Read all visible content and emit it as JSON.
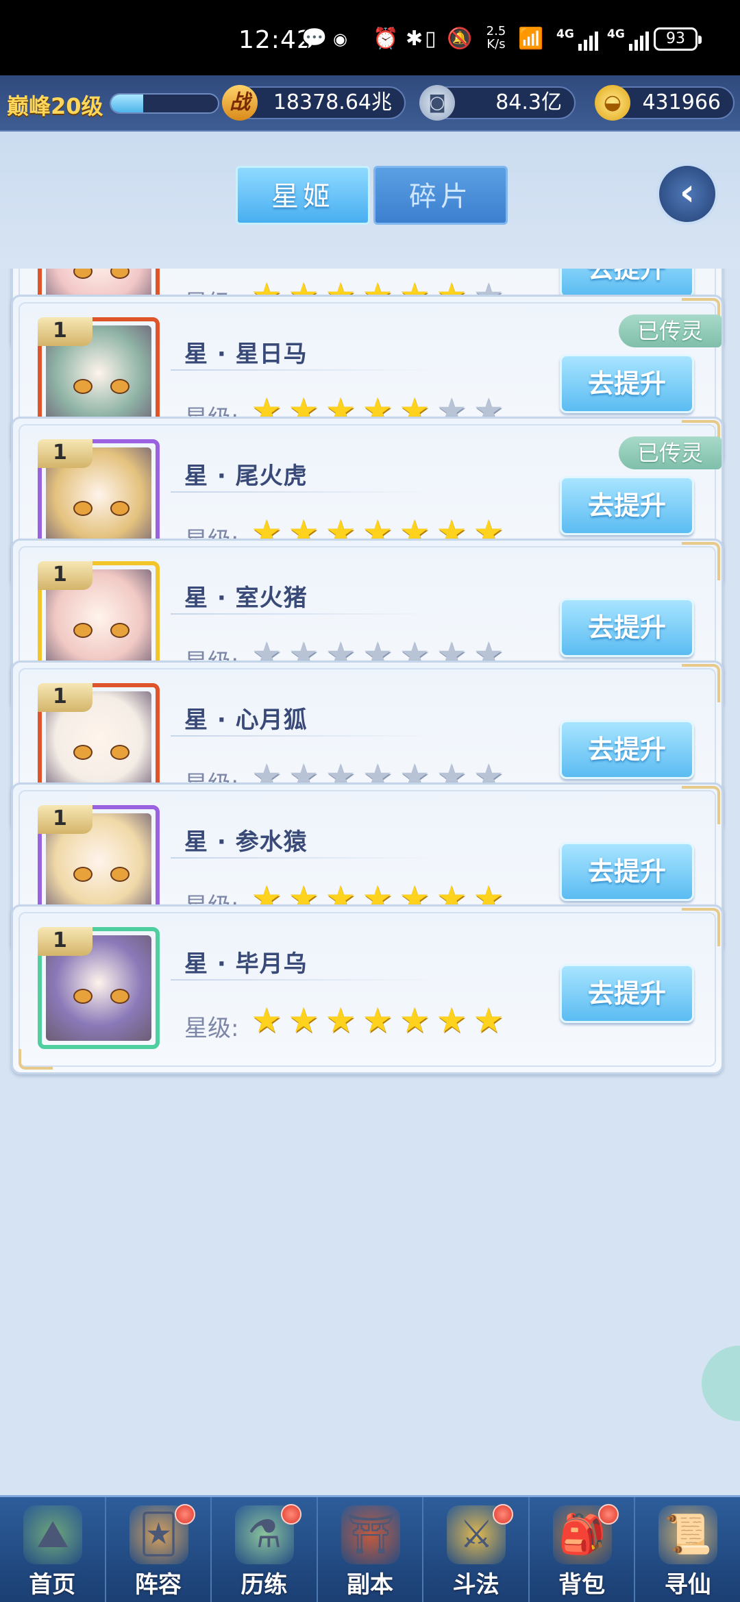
{
  "status_bar": {
    "time": "12:42",
    "net_speed_value": "2.5",
    "net_speed_unit": "K/s",
    "signal1_label": "4G",
    "signal2_label": "4G",
    "battery": "93"
  },
  "resources": {
    "rank": "巅峰20级",
    "level_progress": 0.3,
    "power_icon": "战",
    "power": "18378.64兆",
    "silver": "84.3亿",
    "gold": "431966"
  },
  "tabs": [
    {
      "label": "星姬",
      "active": true
    },
    {
      "label": "碎片",
      "active": false
    }
  ],
  "star_label": "星级:",
  "upgrade_label": "去提升",
  "heroes": [
    {
      "name": "",
      "level": "",
      "stars_on": 6,
      "stars_total": 7,
      "badge": "",
      "frame": "#e0542a",
      "face": "#f2c7c7"
    },
    {
      "name": "星 · 星日马",
      "level": "1",
      "stars_on": 5,
      "stars_total": 7,
      "badge": "已传灵",
      "frame": "#e0542a",
      "face": "#8fb4a6"
    },
    {
      "name": "星 · 尾火虎",
      "level": "1",
      "stars_on": 7,
      "stars_total": 7,
      "badge": "已传灵",
      "frame": "#9a62e0",
      "face": "#e4c27e"
    },
    {
      "name": "星 · 室火猪",
      "level": "1",
      "stars_on": 0,
      "stars_total": 7,
      "badge": "",
      "frame": "#f2c52a",
      "face": "#f1c9c4"
    },
    {
      "name": "星 · 心月狐",
      "level": "1",
      "stars_on": 0,
      "stars_total": 7,
      "badge": "",
      "frame": "#e0542a",
      "face": "#f4ede6"
    },
    {
      "name": "星 · 参水猿",
      "level": "1",
      "stars_on": 7,
      "stars_total": 7,
      "badge": "",
      "frame": "#9a62e0",
      "face": "#f0d9a8"
    },
    {
      "name": "星 · 毕月乌",
      "level": "1",
      "stars_on": 7,
      "stars_total": 7,
      "badge": "",
      "frame": "#4fcfa0",
      "face": "#8a79b8"
    }
  ],
  "bottom_nav": [
    {
      "label": "首页",
      "icon": "home-icon",
      "glyph": "⛰",
      "dot": false
    },
    {
      "label": "阵容",
      "icon": "lineup-icon",
      "glyph": "🃏",
      "dot": true
    },
    {
      "label": "历练",
      "icon": "training-icon",
      "glyph": "⚗",
      "dot": true
    },
    {
      "label": "副本",
      "icon": "dungeon-icon",
      "glyph": "⛩",
      "dot": false
    },
    {
      "label": "斗法",
      "icon": "battle-icon",
      "glyph": "⚔",
      "dot": true
    },
    {
      "label": "背包",
      "icon": "bag-icon",
      "glyph": "🎒",
      "dot": true
    },
    {
      "label": "寻仙",
      "icon": "seek-immortal-icon",
      "glyph": "📜",
      "dot": false
    }
  ]
}
